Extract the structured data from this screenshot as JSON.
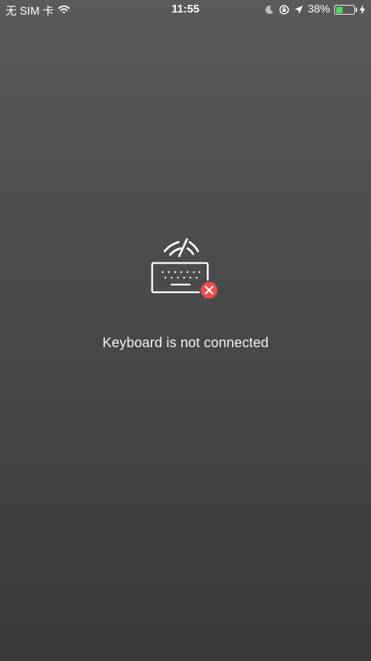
{
  "status_bar": {
    "carrier": "无 SIM 卡",
    "time": "11:55",
    "battery_percent_text": "38%",
    "battery_level": 0.38,
    "icons": [
      "wifi-icon",
      "moon-icon",
      "orientation-lock-icon",
      "location-arrow-icon",
      "battery-icon",
      "charging-bolt-icon"
    ]
  },
  "main": {
    "illustration": "keyboard-disconnected-icon",
    "message": "Keyboard is not connected"
  },
  "colors": {
    "background_top": "#5a5a5a",
    "background_bottom": "#3a3a3a",
    "error_badge": "#ef4b4b",
    "battery_fill": "#4cd964"
  }
}
